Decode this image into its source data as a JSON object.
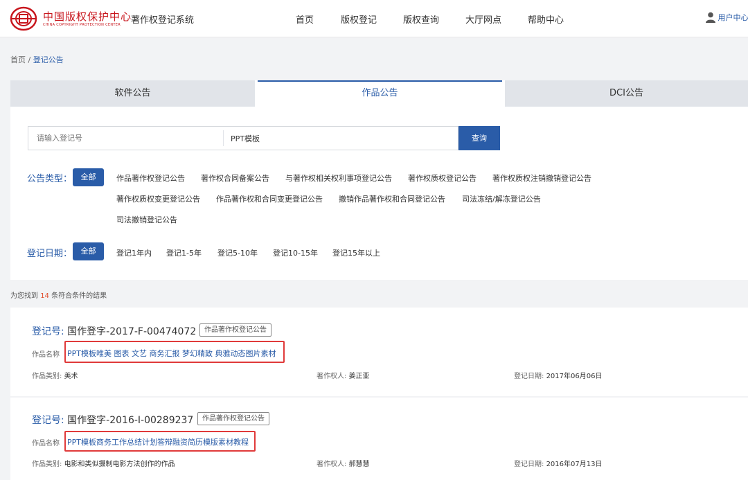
{
  "header": {
    "logo_cn": "中国版权保护中心",
    "logo_en": "CHINA COPYRIGHT PROTECTION CENTER",
    "system_name": "著作权登记系统",
    "nav": [
      "首页",
      "版权登记",
      "版权查询",
      "大厅网点",
      "帮助中心"
    ],
    "user_label": "用户中心"
  },
  "breadcrumb": {
    "home": "首页",
    "separator": "/",
    "current": "登记公告"
  },
  "tabs": [
    {
      "label": "软件公告",
      "active": false
    },
    {
      "label": "作品公告",
      "active": true
    },
    {
      "label": "DCI公告",
      "active": false
    }
  ],
  "search": {
    "reg_no_placeholder": "请输入登记号",
    "keyword_value": "PPT模板",
    "button": "查询"
  },
  "filters": {
    "type_label": "公告类型：",
    "type_all": "全部",
    "types": [
      "作品著作权登记公告",
      "著作权合同备案公告",
      "与著作权相关权利事项登记公告",
      "著作权质权登记公告",
      "著作权质权注销撤销登记公告",
      "著作权质权变更登记公告",
      "作品著作权和合同变更登记公告",
      "撤销作品著作权和合同登记公告",
      "司法冻结/解冻登记公告",
      "司法撤销登记公告"
    ],
    "date_label": "登记日期：",
    "date_all": "全部",
    "dates": [
      "登记1年内",
      "登记1-5年",
      "登记5-10年",
      "登记10-15年",
      "登记15年以上"
    ]
  },
  "results": {
    "prefix": "为您找到",
    "count": "14",
    "suffix": "条符合条件的结果",
    "items": [
      {
        "reg_label": "登记号:",
        "reg_no": "国作登字-2017-F-00474072",
        "tag": "作品著作权登记公告",
        "name_label": "作品名称",
        "name": "PPT模板唯美 图表 文艺 商务汇报 梦幻精致 典雅动态图片素材",
        "category_label": "作品类别:",
        "category": "美术",
        "owner_label": "著作权人:",
        "owner": "姜正亚",
        "date_label": "登记日期:",
        "date": "2017年06月06日"
      },
      {
        "reg_label": "登记号:",
        "reg_no": "国作登字-2016-I-00289237",
        "tag": "作品著作权登记公告",
        "name_label": "作品名称",
        "name": "PPT模板商务工作总结计划答辩融资简历模版素材教程",
        "category_label": "作品类别:",
        "category": "电影和类似摄制电影方法创作的作品",
        "owner_label": "著作权人:",
        "owner": "郝慧慧",
        "date_label": "登记日期:",
        "date": "2016年07月13日"
      }
    ]
  },
  "colors": {
    "brand_red": "#c8161d",
    "accent_blue": "#2a5ca8",
    "highlight_red": "#e03a3a",
    "count_red": "#e04b2a"
  }
}
